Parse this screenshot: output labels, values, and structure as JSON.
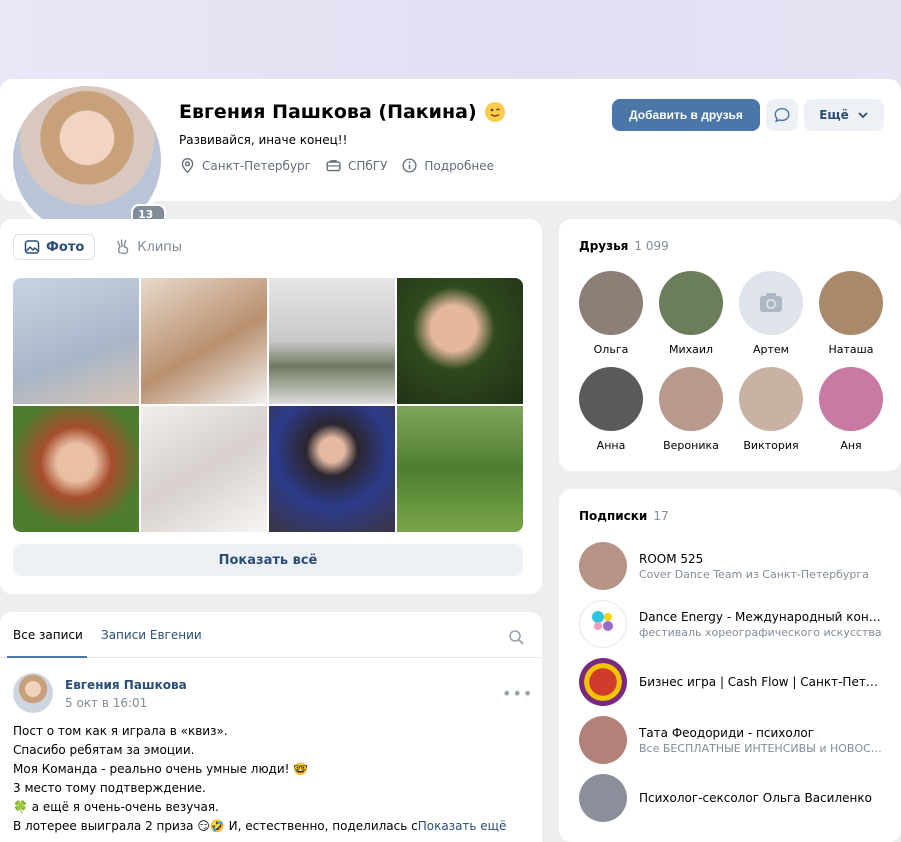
{
  "profile": {
    "name": "Евгения Пашкова (Пакина)",
    "status": "Развивайся, иначе конец!!",
    "online_badge": "13 ч",
    "city": "Санкт-Петербург",
    "university": "СПбГУ",
    "details_label": "Подробнее",
    "add_friend_label": "Добавить в друзья",
    "more_label": "Ещё"
  },
  "photos": {
    "tabs": [
      {
        "label": "Фото",
        "active": true
      },
      {
        "label": "Клипы",
        "active": false
      }
    ],
    "show_all_label": "Показать всё",
    "tiles": [
      "#b6c4d4",
      "#d9c2b2",
      "#cfcfcf",
      "#3f5a2a",
      "#c6593b",
      "#e8e3e0",
      "#3a3441",
      "#5f8a3c"
    ]
  },
  "wall": {
    "tabs": [
      {
        "label": "Все записи",
        "active": true
      },
      {
        "label": "Записи Евгении",
        "active": false
      }
    ],
    "post": {
      "author": "Евгения Пашкова",
      "date": "5 окт в 16:01",
      "lines": [
        "Пост о том как я играла в «квиз».",
        "Спасибо ребятам за эмоции.",
        "Моя Команда - реально очень умные люди! 🤓",
        "3 место тому подтверждение.",
        "🍀 а ещё я очень-очень везучая.",
        "В лотерее выиграла 2 приза 😏🤣 И, естественно, поделилась с"
      ],
      "show_more": "Показать ещё"
    }
  },
  "friends": {
    "title": "Друзья",
    "count": "1 099",
    "items": [
      {
        "name": "Ольга",
        "color": "#8c7f78"
      },
      {
        "name": "Михаил",
        "color": "#6b7d5a"
      },
      {
        "name": "Артем",
        "color": "#dfe4ea"
      },
      {
        "name": "Наташа",
        "color": "#a88a6b"
      },
      {
        "name": "Анна",
        "color": "#5a5a5a"
      },
      {
        "name": "Вероника",
        "color": "#b79a8c"
      },
      {
        "name": "Виктория",
        "color": "#c9b2a4"
      },
      {
        "name": "Аня",
        "color": "#c97aa2"
      }
    ]
  },
  "subscriptions": {
    "title": "Подписки",
    "count": "17",
    "items": [
      {
        "name": "ROOM 525",
        "desc": "Cover Dance Team из Санкт-Петербурга",
        "color": "#b79388"
      },
      {
        "name": "Dance Energy - Международный конку…",
        "desc": "фестиваль хореографического искусства",
        "color": "#ffffff"
      },
      {
        "name": "Бизнес игра | Cash Flow | Санкт-Петер…",
        "desc": "",
        "color": "#7a2a7e"
      },
      {
        "name": "Тата Феодориди - психолог",
        "desc": "Все БЕСПЛАТНЫЕ ИНТЕНСИВЫ и НОВОС…",
        "color": "#b28278"
      },
      {
        "name": "Психолог-сексолог Ольга Василенко",
        "desc": "",
        "color": "#8a8f9a"
      }
    ]
  }
}
